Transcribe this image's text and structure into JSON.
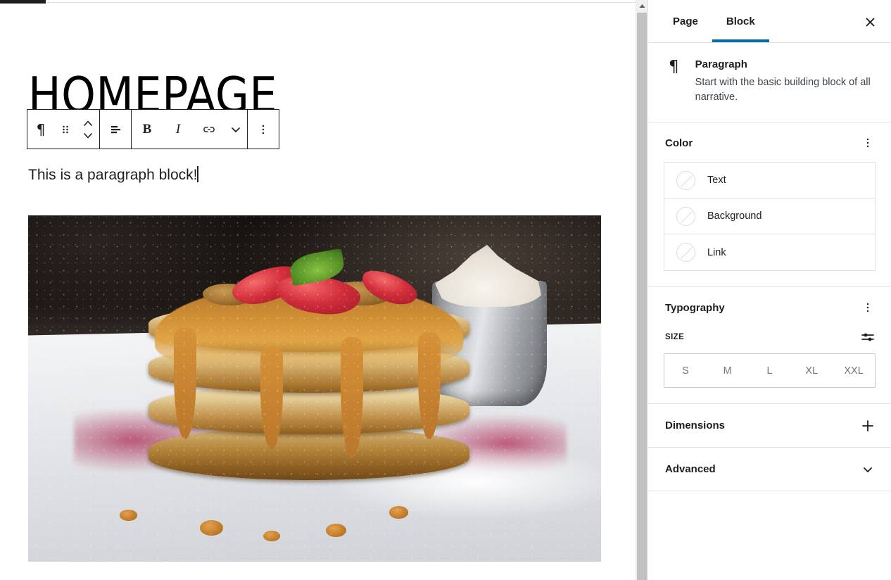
{
  "editor": {
    "heading": "HOMEPAGE",
    "paragraph": "This is a paragraph block!",
    "image_alt": "Stack of pancakes with caramel sauce, strawberries and whipped cream"
  },
  "toolbar": {
    "block_type_icon": "paragraph-icon",
    "drag_icon": "drag-handle-icon",
    "move_up_icon": "chevron-up-icon",
    "move_down_icon": "chevron-down-icon",
    "align_icon": "align-text-icon",
    "bold_label": "B",
    "italic_label": "I",
    "link_icon": "link-icon",
    "more_formats_icon": "chevron-down-icon",
    "options_icon": "more-vertical-icon"
  },
  "sidebar": {
    "tabs": [
      {
        "label": "Page",
        "active": false
      },
      {
        "label": "Block",
        "active": true
      }
    ],
    "close_icon": "close-icon",
    "accent_color": "#0a6ca5",
    "block_card": {
      "icon": "¶",
      "title": "Paragraph",
      "description": "Start with the basic building block of all narrative."
    },
    "color_panel": {
      "title": "Color",
      "options_icon": "more-vertical-icon",
      "rows": [
        {
          "label": "Text",
          "swatch": "none"
        },
        {
          "label": "Background",
          "swatch": "none"
        },
        {
          "label": "Link",
          "swatch": "none"
        }
      ]
    },
    "typography_panel": {
      "title": "Typography",
      "options_icon": "more-vertical-icon",
      "size_label": "SIZE",
      "size_settings_icon": "sliders-icon",
      "sizes": [
        "S",
        "M",
        "L",
        "XL",
        "XXL"
      ]
    },
    "dimensions_panel": {
      "title": "Dimensions",
      "toggle_icon": "plus-icon"
    },
    "advanced_panel": {
      "title": "Advanced",
      "toggle_icon": "chevron-down-icon"
    }
  },
  "scrollbar": {
    "up_arrow_icon": "caret-up-icon"
  }
}
